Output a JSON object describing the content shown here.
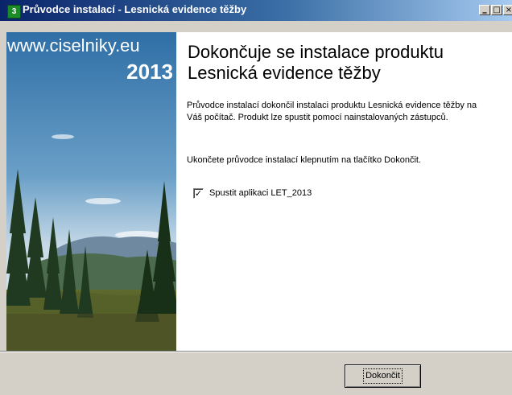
{
  "window": {
    "title": "Průvodce instalací - Lesnická evidence těžby",
    "icon": "installer-icon",
    "controls": [
      "minimize",
      "maximize",
      "close"
    ]
  },
  "side_panel": {
    "url": "www.ciselniky.eu",
    "year": "2013",
    "image": "forest-landscape"
  },
  "content": {
    "heading": "Dokončuje se instalace produktu Lesnická evidence těžby",
    "description": "Průvodce instalací dokončil instalaci produktu Lesnická evidence těžby na Váš počítač. Produkt lze spustit pomocí nainstalovaných zástupců.",
    "finish_hint": "Ukončete průvodce instalací klepnutím na tlačítko Dokončit.",
    "checkbox": {
      "label": "Spustit aplikaci LET_2013",
      "checked": true
    }
  },
  "buttons": {
    "finish": "Dokončit"
  },
  "colors": {
    "titlebar_start": "#0a246a",
    "titlebar_end": "#a6caf0",
    "dialog_bg": "#d4d0c8"
  }
}
